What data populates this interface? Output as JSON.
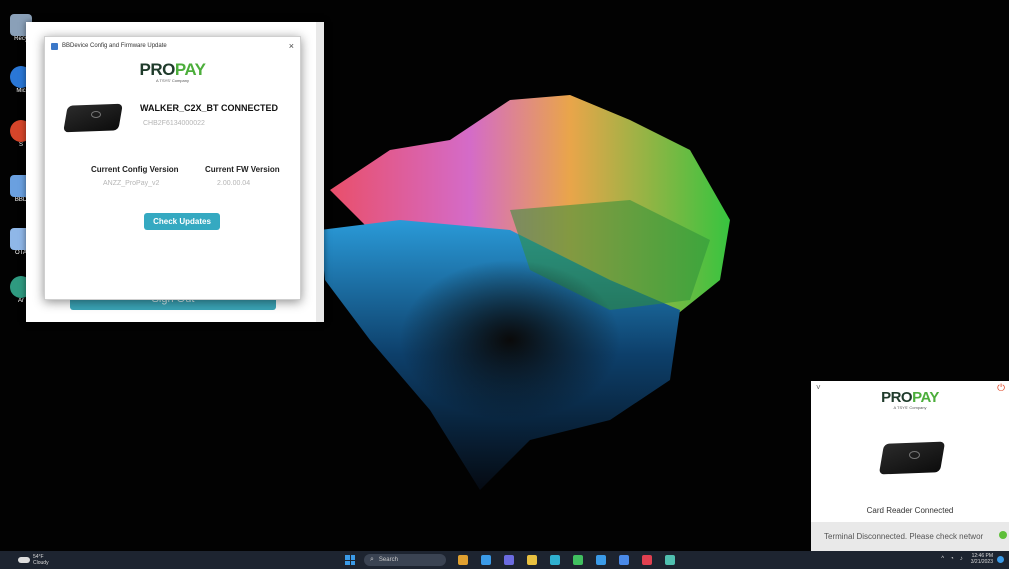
{
  "desktop": {
    "icons": [
      {
        "label": "Recy",
        "color": "#8aa0b8"
      },
      {
        "label": "Mic",
        "color": "#2a77d6"
      },
      {
        "label": "S",
        "color": "#d6452a"
      },
      {
        "label": "BBD",
        "color": "#6aa0e0"
      },
      {
        "label": "OTA",
        "color": "#8fb7e8"
      },
      {
        "label": "Ar",
        "color": "#2f9a80"
      }
    ]
  },
  "back_window": {
    "signout_label": "Sign Out"
  },
  "dialog": {
    "title": "BBDevice Config and Firmware Update",
    "close": "×",
    "logo_pro": "PRO",
    "logo_pay": "PAY",
    "logo_tagline": "A TSYS' Company",
    "device_name": "WALKER_C2X_BT CONNECTED",
    "device_serial": "CHB2F6134000022",
    "config_heading": "Current Config Version",
    "fw_heading": "Current FW Version",
    "config_value": "ANZZ_ProPay_v2",
    "fw_value": "2.00.00.04",
    "check_updates_label": "Check Updates"
  },
  "panel": {
    "chevron": "˅",
    "power": "⏻",
    "logo_pro": "PRO",
    "logo_pay": "PAY",
    "logo_tagline": "A TSYS' Company",
    "reader_status": "Card Reader Connected",
    "terminal_status": "Terminal Disconnected. Please check networ"
  },
  "taskbar": {
    "weather_temp": "54°F",
    "weather_desc": "Cloudy",
    "search_placeholder": "Search",
    "tray_chevron": "^",
    "clock_time": "12:46 PM",
    "clock_date": "3/21/2023",
    "apps": [
      "#e0a030",
      "#3b9be8",
      "#6b6be0",
      "#e8c040",
      "#2fb0d0",
      "#40c060",
      "#3b9be8",
      "#4a8ae8",
      "#e04050",
      "#50c0b0"
    ]
  },
  "colors": {
    "accent": "#35a9c1",
    "brand_green": "#4cae3b",
    "brand_dark": "#1f3b2b"
  }
}
